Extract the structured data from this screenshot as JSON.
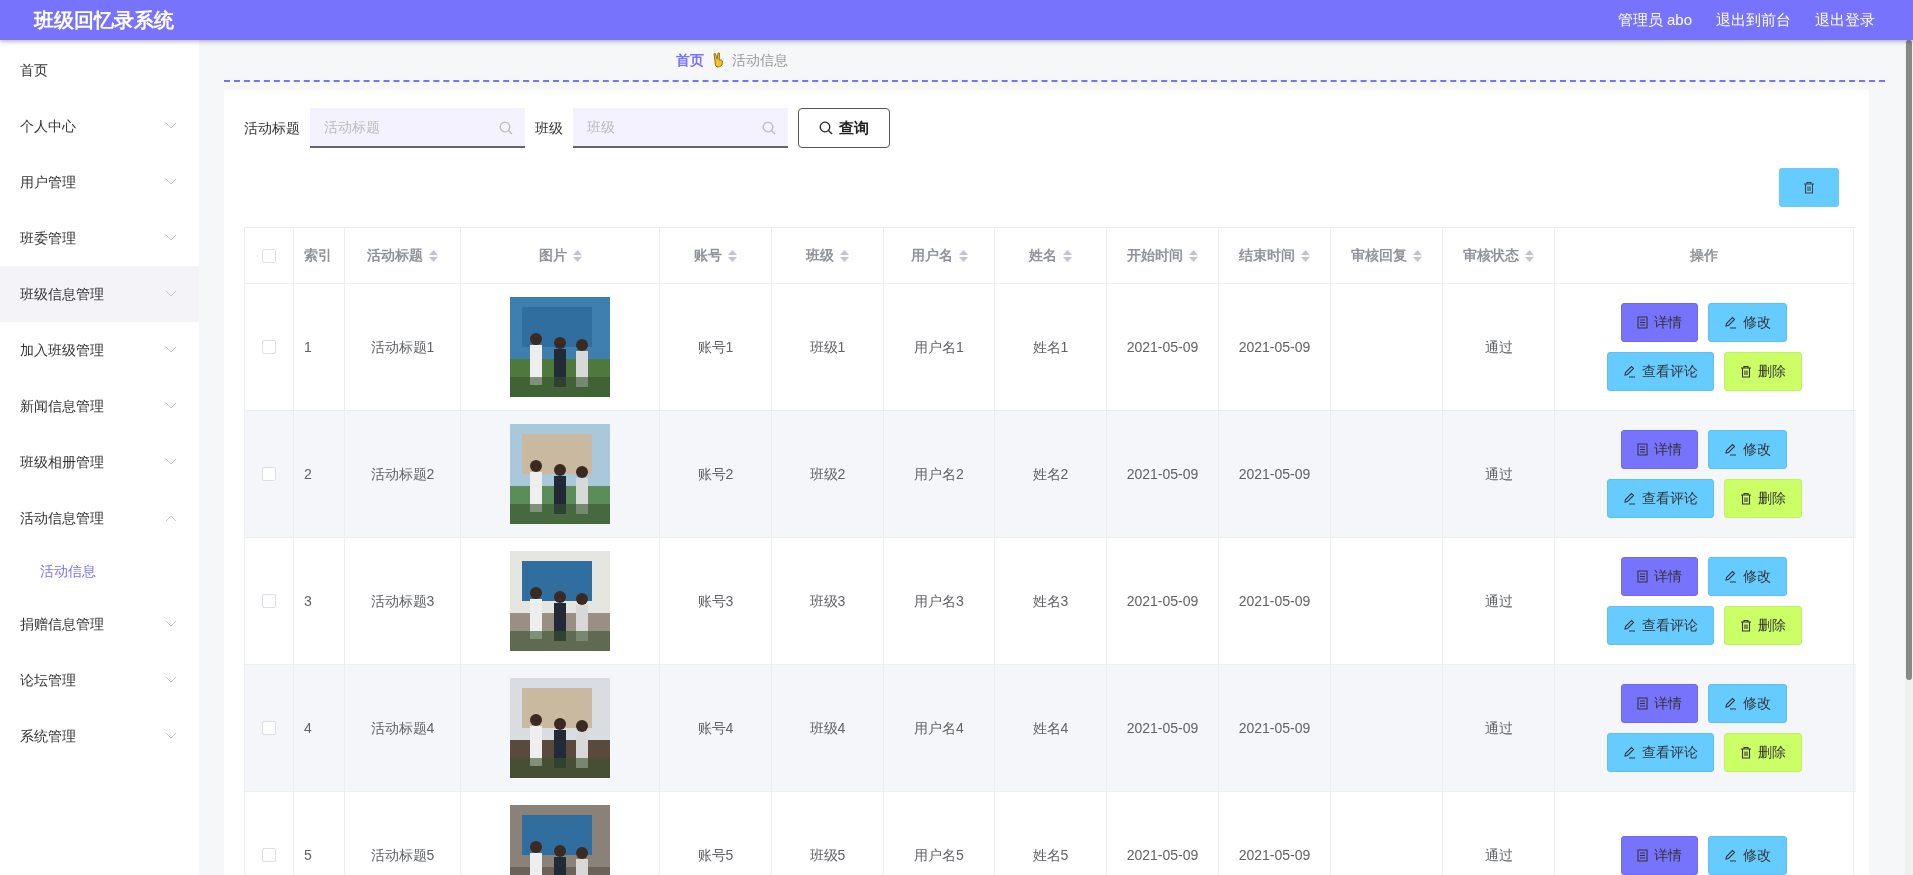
{
  "header": {
    "title": "班级回忆录系统",
    "links": [
      "管理员 abo",
      "退出到前台",
      "退出登录"
    ]
  },
  "sidebar": {
    "items": [
      {
        "label": "首页",
        "has_children": false,
        "hovered": false
      },
      {
        "label": "个人中心",
        "has_children": true,
        "expanded": false,
        "hovered": false
      },
      {
        "label": "用户管理",
        "has_children": true,
        "expanded": false,
        "hovered": false
      },
      {
        "label": "班委管理",
        "has_children": true,
        "expanded": false,
        "hovered": false
      },
      {
        "label": "班级信息管理",
        "has_children": true,
        "expanded": false,
        "hovered": true
      },
      {
        "label": "加入班级管理",
        "has_children": true,
        "expanded": false,
        "hovered": false
      },
      {
        "label": "新闻信息管理",
        "has_children": true,
        "expanded": false,
        "hovered": false
      },
      {
        "label": "班级相册管理",
        "has_children": true,
        "expanded": false,
        "hovered": false
      },
      {
        "label": "活动信息管理",
        "has_children": true,
        "expanded": true,
        "hovered": false,
        "children": [
          {
            "label": "活动信息",
            "selected": true
          }
        ]
      },
      {
        "label": "捐赠信息管理",
        "has_children": true,
        "expanded": false,
        "hovered": false
      },
      {
        "label": "论坛管理",
        "has_children": true,
        "expanded": false,
        "hovered": false
      },
      {
        "label": "系统管理",
        "has_children": true,
        "expanded": false,
        "hovered": false
      }
    ]
  },
  "breadcrumb": [
    "首页",
    "活动信息"
  ],
  "search": {
    "fields": [
      {
        "label": "活动标题",
        "placeholder": "活动标题"
      },
      {
        "label": "班级",
        "placeholder": "班级"
      }
    ],
    "button": "查询"
  },
  "table": {
    "all_checked": false,
    "columns": [
      {
        "label": "索引",
        "sortable": false
      },
      {
        "label": "活动标题",
        "sortable": true
      },
      {
        "label": "图片",
        "sortable": true
      },
      {
        "label": "账号",
        "sortable": true
      },
      {
        "label": "班级",
        "sortable": true
      },
      {
        "label": "用户名",
        "sortable": true
      },
      {
        "label": "姓名",
        "sortable": true
      },
      {
        "label": "开始时间",
        "sortable": true
      },
      {
        "label": "结束时间",
        "sortable": true
      },
      {
        "label": "审核回复",
        "sortable": true
      },
      {
        "label": "审核状态",
        "sortable": true
      },
      {
        "label": "操作",
        "sortable": false
      }
    ],
    "rows": [
      {
        "checked": false,
        "index": "1",
        "title": "活动标题1",
        "account": "账号1",
        "class": "班级1",
        "username": "用户名1",
        "name": "姓名1",
        "start": "2021-05-09",
        "end": "2021-05-09",
        "status": "通过",
        "actions": [
          "详情",
          "修改",
          "查看评论",
          "删除"
        ]
      },
      {
        "checked": false,
        "index": "2",
        "title": "活动标题2",
        "account": "账号2",
        "class": "班级2",
        "username": "用户名2",
        "name": "姓名2",
        "start": "2021-05-09",
        "end": "2021-05-09",
        "status": "通过",
        "actions": [
          "详情",
          "修改",
          "查看评论",
          "删除"
        ]
      },
      {
        "checked": false,
        "index": "3",
        "title": "活动标题3",
        "account": "账号3",
        "class": "班级3",
        "username": "用户名3",
        "name": "姓名3",
        "start": "2021-05-09",
        "end": "2021-05-09",
        "status": "通过",
        "actions": [
          "详情",
          "修改",
          "查看评论",
          "删除"
        ]
      },
      {
        "checked": false,
        "index": "4",
        "title": "活动标题4",
        "account": "账号4",
        "class": "班级4",
        "username": "用户名4",
        "name": "姓名4",
        "start": "2021-05-09",
        "end": "2021-05-09",
        "status": "通过",
        "actions": [
          "详情",
          "修改",
          "查看评论",
          "删除"
        ]
      },
      {
        "checked": false,
        "index": "5",
        "title": "活动标题5",
        "account": "账号5",
        "class": "班级5",
        "username": "用户名5",
        "name": "姓名5",
        "start": "2021-05-09",
        "end": "2021-05-09",
        "status": "通过",
        "actions": [
          "详情",
          "修改"
        ]
      }
    ]
  }
}
